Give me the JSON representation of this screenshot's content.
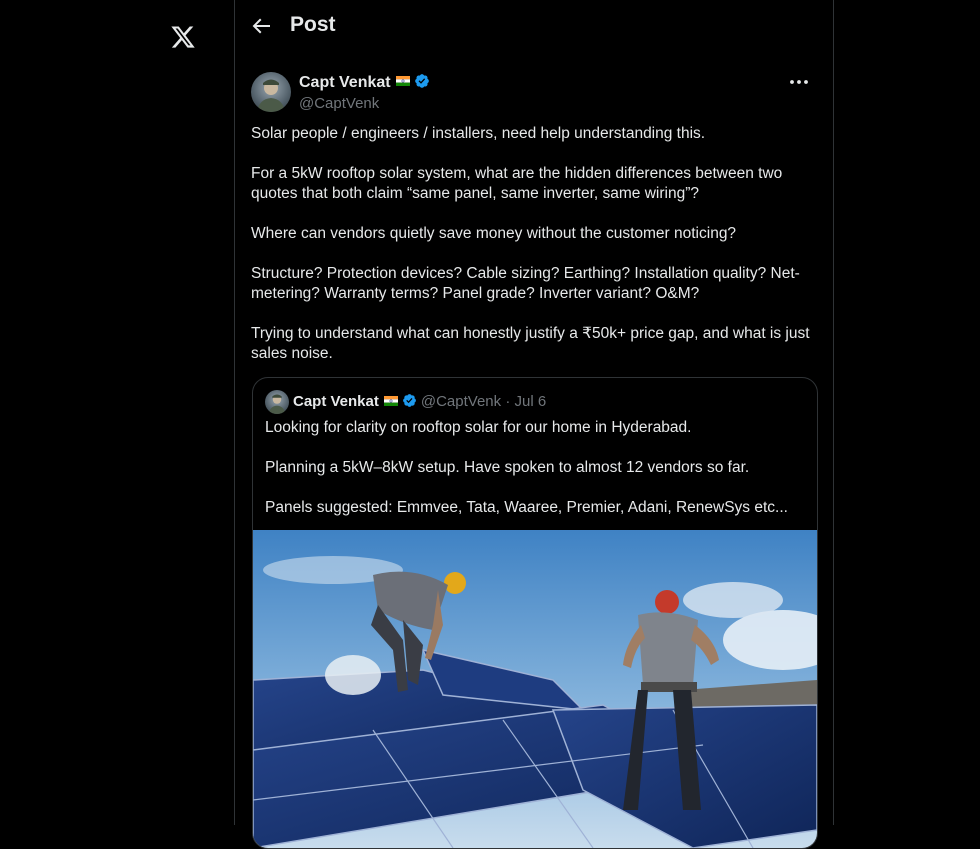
{
  "header": {
    "title": "Post"
  },
  "post": {
    "author_name": "Capt Venkat",
    "author_handle": "@CaptVenk",
    "paragraphs": [
      "Solar people / engineers / installers, need help understanding this.",
      "For a 5kW rooftop solar system, what are the hidden differences between two quotes that both claim “same panel, same inverter, same wiring”?",
      "Where can vendors quietly save money without the customer noticing?",
      "Structure? Protection devices? Cable sizing? Earthing? Installation quality? Net-metering? Warranty terms? Panel grade? Inverter variant? O&M?",
      "Trying to understand what can honestly justify a ₹50k+ price gap, and what is just sales noise."
    ]
  },
  "quoted": {
    "author_name": "Capt Venkat",
    "meta": "@CaptVenk · Jul 6",
    "paragraphs": [
      "Looking for clarity on rooftop solar for our home in Hyderabad.",
      "Planning a 5kW–8kW setup. Have spoken to almost 12 vendors so far.",
      "Panels suggested: Emmvee, Tata, Waaree, Premier, Adani, RenewSys etc..."
    ]
  },
  "icons": {
    "logo": "x-logo-icon",
    "back": "back-arrow-icon",
    "more": "more-dots-icon",
    "verified": "verified-badge-icon",
    "flag": "india-flag-icon"
  },
  "colors": {
    "background": "#000000",
    "text": "#e7e9ea",
    "muted": "#71767b",
    "border": "#2f3336",
    "verified": "#1d9bf0"
  }
}
